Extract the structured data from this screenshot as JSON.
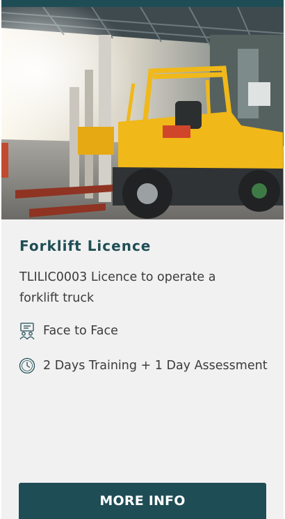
{
  "course": {
    "title": "Forklift Licence",
    "subtitle": "TLILIC0003 Licence to operate a forklift truck",
    "delivery_mode": "Face to Face",
    "duration": "2 Days Training + 1 Day Assessment"
  },
  "cta": {
    "label": "MORE INFO"
  },
  "icons": {
    "delivery": "classroom-people-icon",
    "duration": "clock-icon"
  },
  "colors": {
    "accent": "#1f4d55",
    "forklift": "#f0b819",
    "card_bg": "#f1f1f1"
  }
}
